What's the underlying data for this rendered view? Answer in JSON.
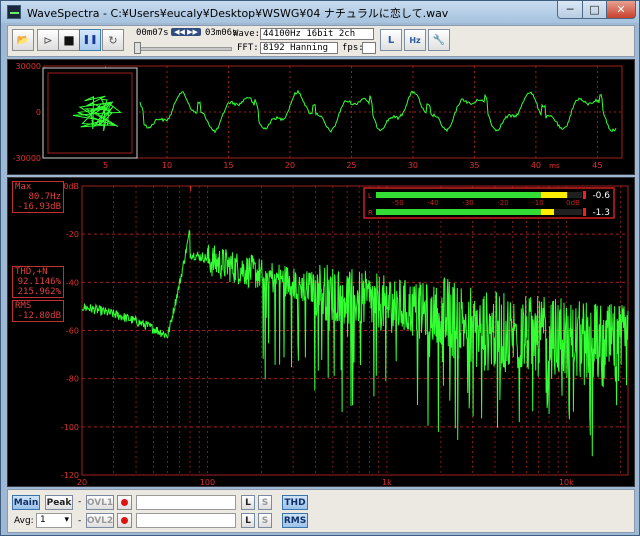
{
  "window": {
    "title": "WaveSpectra - C:¥Users¥eucaly¥Desktop¥WSWG¥04 ナチュラルに恋して.wav",
    "min_glyph": "─",
    "max_glyph": "□",
    "close_glyph": "✕"
  },
  "toolbar": {
    "open_glyph": "📂",
    "back_glyph": "⊳",
    "stop_glyph": "■",
    "pause_glyph": "❚❚",
    "repeat_glyph": "↻",
    "time_elapsed": "00m07s",
    "time_total": "03m06s",
    "wave_label": "Wave:",
    "wave_value": "44100Hz 16bit 2ch",
    "fft_label": "FFT:",
    "fft_value": "8192 Hanning",
    "fps_label": "fps:",
    "fps_value": "",
    "seek_glyph": "◀◀ ▶▶",
    "icon_log": "L",
    "icon_hz": "Hz",
    "icon_settings": "🔧"
  },
  "waveform": {
    "y_ticks": [
      "30000",
      "0",
      "-30000"
    ],
    "x_ticks": [
      "5",
      "10",
      "15",
      "20",
      "25",
      "30",
      "35",
      "40",
      "45"
    ],
    "x_unit": "ms"
  },
  "spectrum": {
    "y_ticks": [
      "0dB",
      "-20",
      "-40",
      "-60",
      "-80",
      "-100",
      "-120"
    ],
    "x_ticks": [
      "20",
      "100",
      "1k",
      "10k"
    ],
    "max_label": "Max",
    "max_freq": "80.7Hz",
    "max_db": "-16.93dB",
    "thd_label": "THD,+N",
    "thd_l": "92.1146%",
    "thd_r": "215.962%",
    "rms_label": "RMS",
    "rms_value": "-12.80dB",
    "meter": {
      "scale": [
        "-50",
        "-40",
        "-30",
        "-20",
        "-10",
        "0dB"
      ],
      "left_label": "L",
      "right_label": "R",
      "left_db": "-0.6",
      "right_db": "-1.3",
      "left_level": 0.84,
      "right_level": 0.82
    },
    "colors": {
      "trace": "#33ff33",
      "grid": "#a02020",
      "label": "#e03030"
    }
  },
  "bottom": {
    "main_label": "Main",
    "peak_label": "Peak",
    "ovl1_label": "OVL1",
    "ovl2_label": "OVL2",
    "l_label": "L",
    "s_label": "S",
    "thd_label": "THD",
    "rms_label": "RMS",
    "avg_label": "Avg:",
    "avg_value": "1",
    "dash": "-"
  }
}
